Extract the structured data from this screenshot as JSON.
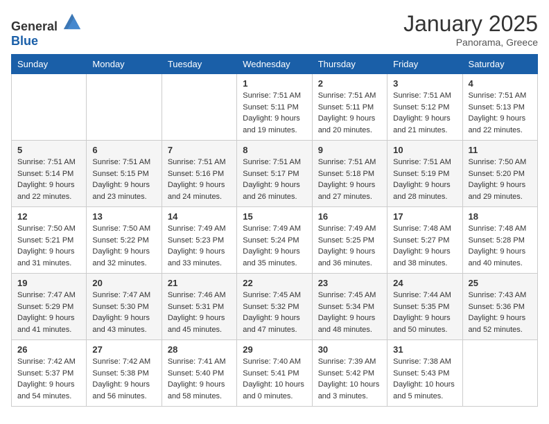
{
  "header": {
    "logo_general": "General",
    "logo_blue": "Blue",
    "month": "January 2025",
    "location": "Panorama, Greece"
  },
  "weekdays": [
    "Sunday",
    "Monday",
    "Tuesday",
    "Wednesday",
    "Thursday",
    "Friday",
    "Saturday"
  ],
  "weeks": [
    [
      {
        "day": "",
        "info": ""
      },
      {
        "day": "",
        "info": ""
      },
      {
        "day": "",
        "info": ""
      },
      {
        "day": "1",
        "info": "Sunrise: 7:51 AM\nSunset: 5:11 PM\nDaylight: 9 hours\nand 19 minutes."
      },
      {
        "day": "2",
        "info": "Sunrise: 7:51 AM\nSunset: 5:11 PM\nDaylight: 9 hours\nand 20 minutes."
      },
      {
        "day": "3",
        "info": "Sunrise: 7:51 AM\nSunset: 5:12 PM\nDaylight: 9 hours\nand 21 minutes."
      },
      {
        "day": "4",
        "info": "Sunrise: 7:51 AM\nSunset: 5:13 PM\nDaylight: 9 hours\nand 22 minutes."
      }
    ],
    [
      {
        "day": "5",
        "info": "Sunrise: 7:51 AM\nSunset: 5:14 PM\nDaylight: 9 hours\nand 22 minutes."
      },
      {
        "day": "6",
        "info": "Sunrise: 7:51 AM\nSunset: 5:15 PM\nDaylight: 9 hours\nand 23 minutes."
      },
      {
        "day": "7",
        "info": "Sunrise: 7:51 AM\nSunset: 5:16 PM\nDaylight: 9 hours\nand 24 minutes."
      },
      {
        "day": "8",
        "info": "Sunrise: 7:51 AM\nSunset: 5:17 PM\nDaylight: 9 hours\nand 26 minutes."
      },
      {
        "day": "9",
        "info": "Sunrise: 7:51 AM\nSunset: 5:18 PM\nDaylight: 9 hours\nand 27 minutes."
      },
      {
        "day": "10",
        "info": "Sunrise: 7:51 AM\nSunset: 5:19 PM\nDaylight: 9 hours\nand 28 minutes."
      },
      {
        "day": "11",
        "info": "Sunrise: 7:50 AM\nSunset: 5:20 PM\nDaylight: 9 hours\nand 29 minutes."
      }
    ],
    [
      {
        "day": "12",
        "info": "Sunrise: 7:50 AM\nSunset: 5:21 PM\nDaylight: 9 hours\nand 31 minutes."
      },
      {
        "day": "13",
        "info": "Sunrise: 7:50 AM\nSunset: 5:22 PM\nDaylight: 9 hours\nand 32 minutes."
      },
      {
        "day": "14",
        "info": "Sunrise: 7:49 AM\nSunset: 5:23 PM\nDaylight: 9 hours\nand 33 minutes."
      },
      {
        "day": "15",
        "info": "Sunrise: 7:49 AM\nSunset: 5:24 PM\nDaylight: 9 hours\nand 35 minutes."
      },
      {
        "day": "16",
        "info": "Sunrise: 7:49 AM\nSunset: 5:25 PM\nDaylight: 9 hours\nand 36 minutes."
      },
      {
        "day": "17",
        "info": "Sunrise: 7:48 AM\nSunset: 5:27 PM\nDaylight: 9 hours\nand 38 minutes."
      },
      {
        "day": "18",
        "info": "Sunrise: 7:48 AM\nSunset: 5:28 PM\nDaylight: 9 hours\nand 40 minutes."
      }
    ],
    [
      {
        "day": "19",
        "info": "Sunrise: 7:47 AM\nSunset: 5:29 PM\nDaylight: 9 hours\nand 41 minutes."
      },
      {
        "day": "20",
        "info": "Sunrise: 7:47 AM\nSunset: 5:30 PM\nDaylight: 9 hours\nand 43 minutes."
      },
      {
        "day": "21",
        "info": "Sunrise: 7:46 AM\nSunset: 5:31 PM\nDaylight: 9 hours\nand 45 minutes."
      },
      {
        "day": "22",
        "info": "Sunrise: 7:45 AM\nSunset: 5:32 PM\nDaylight: 9 hours\nand 47 minutes."
      },
      {
        "day": "23",
        "info": "Sunrise: 7:45 AM\nSunset: 5:34 PM\nDaylight: 9 hours\nand 48 minutes."
      },
      {
        "day": "24",
        "info": "Sunrise: 7:44 AM\nSunset: 5:35 PM\nDaylight: 9 hours\nand 50 minutes."
      },
      {
        "day": "25",
        "info": "Sunrise: 7:43 AM\nSunset: 5:36 PM\nDaylight: 9 hours\nand 52 minutes."
      }
    ],
    [
      {
        "day": "26",
        "info": "Sunrise: 7:42 AM\nSunset: 5:37 PM\nDaylight: 9 hours\nand 54 minutes."
      },
      {
        "day": "27",
        "info": "Sunrise: 7:42 AM\nSunset: 5:38 PM\nDaylight: 9 hours\nand 56 minutes."
      },
      {
        "day": "28",
        "info": "Sunrise: 7:41 AM\nSunset: 5:40 PM\nDaylight: 9 hours\nand 58 minutes."
      },
      {
        "day": "29",
        "info": "Sunrise: 7:40 AM\nSunset: 5:41 PM\nDaylight: 10 hours\nand 0 minutes."
      },
      {
        "day": "30",
        "info": "Sunrise: 7:39 AM\nSunset: 5:42 PM\nDaylight: 10 hours\nand 3 minutes."
      },
      {
        "day": "31",
        "info": "Sunrise: 7:38 AM\nSunset: 5:43 PM\nDaylight: 10 hours\nand 5 minutes."
      },
      {
        "day": "",
        "info": ""
      }
    ]
  ]
}
